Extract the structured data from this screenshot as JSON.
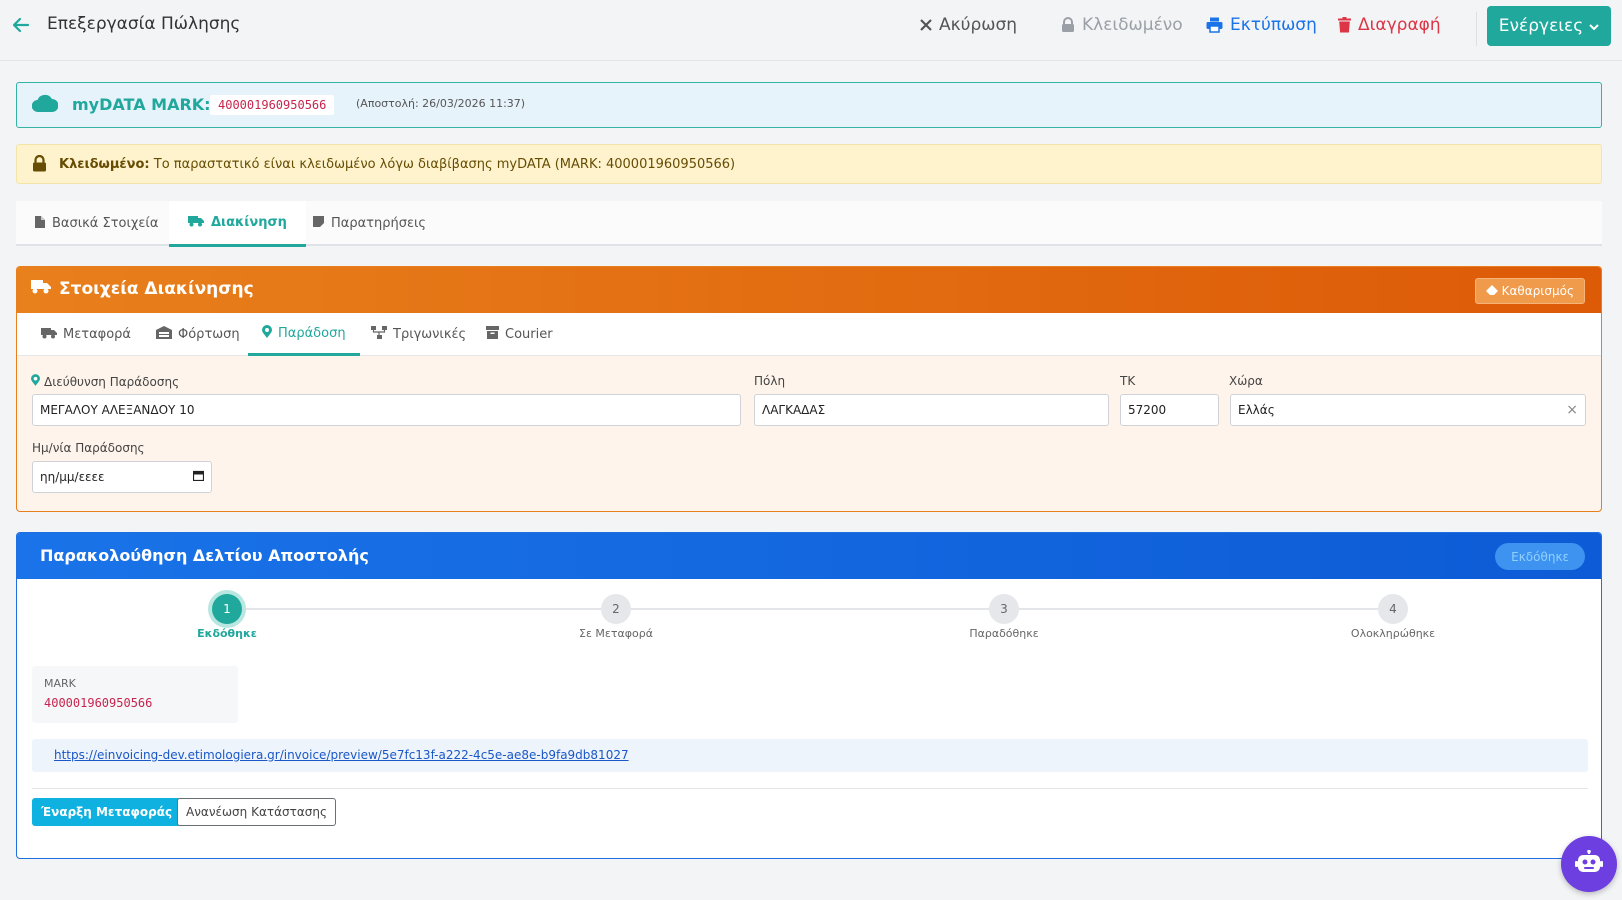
{
  "header": {
    "title": "Επεξεργασία Πώλησης",
    "cancel_label": "Ακύρωση",
    "locked_label": "Κλειδωμένο",
    "print_label": "Εκτύπωση",
    "delete_label": "Διαγραφή",
    "actions_label": "Ενέργειες"
  },
  "mydata": {
    "label": "myDATA MARK:",
    "mark": "400001960950566",
    "sent": "(Αποστολή: 26/03/2026 11:37)"
  },
  "lock_notice": {
    "strong": "Κλειδωμένο:",
    "text": "Το παραστατικό είναι κλειδωμένο λόγω διαβίβασης myDATA (MARK: 400001960950566)"
  },
  "tabs": [
    "Βασικά Στοιχεία",
    "Διακίνηση",
    "Παρατηρήσεις"
  ],
  "movement": {
    "title": "Στοιχεία Διακίνησης",
    "clear_label": "Καθαρισμός",
    "subtabs": [
      "Μεταφορά",
      "Φόρτωση",
      "Παράδοση",
      "Τριγωνικές",
      "Courier"
    ],
    "fields": {
      "address_label": "Διεύθυνση Παράδοσης",
      "address_value": "ΜΕΓΑΛΟΥ ΑΛΕΞΑΝΔΟΥ 10",
      "city_label": "Πόλη",
      "city_value": "ΛΑΓΚΑΔΑΣ",
      "zip_label": "ΤΚ",
      "zip_value": "57200",
      "country_label": "Χώρα",
      "country_value": "Ελλάς",
      "date_label": "Ημ/νία Παράδοσης",
      "date_placeholder": "ηη/μμ/εεεε"
    }
  },
  "tracking": {
    "title": "Παρακολούθηση Δελτίου Αποστολής",
    "status_badge": "Εκδόθηκε",
    "steps": [
      {
        "num": "1",
        "label": "Εκδόθηκε"
      },
      {
        "num": "2",
        "label": "Σε Μεταφορά"
      },
      {
        "num": "3",
        "label": "Παραδόθηκε"
      },
      {
        "num": "4",
        "label": "Ολοκληρώθηκε"
      }
    ],
    "mark_label": "MARK",
    "mark_value": "400001960950566",
    "link": "https://einvoicing-dev.etimologiera.gr/invoice/preview/5e7fc13f-a222-4c5e-ae8e-b9fa9db81027",
    "start_label": "Έναρξη Μεταφοράς",
    "refresh_label": "Ανανέωση Κατάστασης"
  },
  "colors": {
    "teal": "#20a89c",
    "orange": "#e8801c",
    "blue": "#1a73e8",
    "red": "#dc3545"
  }
}
